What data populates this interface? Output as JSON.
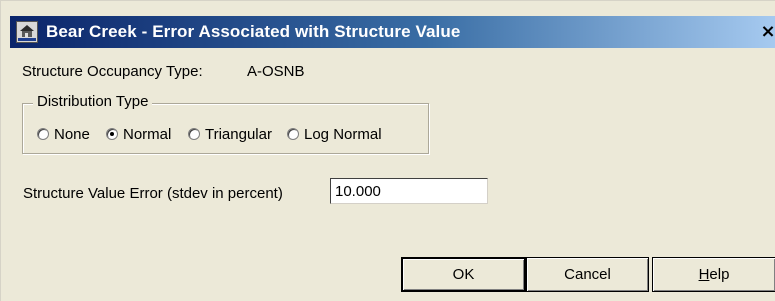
{
  "window": {
    "title": "Bear Creek - Error Associated with Structure Value",
    "close_glyph": "×",
    "app_icon": "hec-fda-app-icon",
    "close_icon": "close-icon"
  },
  "occupancy": {
    "label": "Structure Occupancy Type:",
    "value": "A-OSNB"
  },
  "distribution": {
    "legend": "Distribution Type",
    "selected": "Normal",
    "options": [
      {
        "label": "None",
        "checked": false
      },
      {
        "label": "Normal",
        "checked": true
      },
      {
        "label": "Triangular",
        "checked": false
      },
      {
        "label": "Log Normal",
        "checked": false
      }
    ]
  },
  "error": {
    "label": "Structure Value Error (stdev in percent)",
    "value": "10.000"
  },
  "buttons": {
    "ok": "OK",
    "cancel": "Cancel",
    "help_mnemonic": "H",
    "help_rest": "elp"
  }
}
